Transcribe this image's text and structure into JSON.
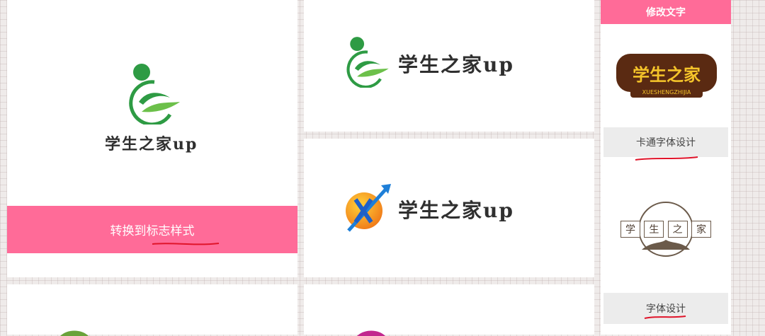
{
  "main_preview": {
    "logo_text": "学生之家up",
    "convert_button": "转换到标志样式"
  },
  "variants": [
    {
      "logo_text": "学生之家up"
    },
    {
      "logo_text": "学生之家up"
    }
  ],
  "sidebar": {
    "edit_text_button": "修改文字",
    "style1_badge_text": "学生之家",
    "style1_badge_subtext": "XUESHENGZHIJIA",
    "cartoon_font_button": "卡通字体设计",
    "style2_chars": [
      "学",
      "生",
      "之",
      "家"
    ],
    "font_design_button": "字体设计"
  },
  "colors": {
    "accent_pink": "#ff6b98",
    "brand_green": "#2e9b44",
    "annotation_red": "#e0142a"
  }
}
